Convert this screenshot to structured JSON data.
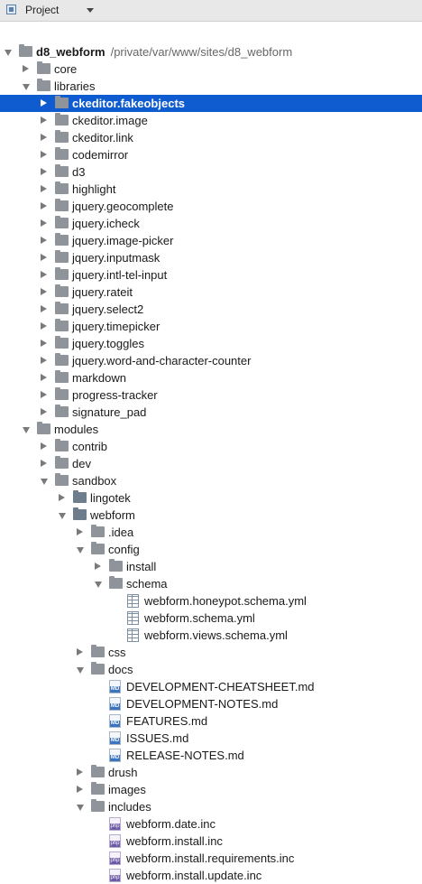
{
  "header": {
    "title": "Project"
  },
  "tree": [
    {
      "label": "d8_webform",
      "path": "/private/var/www/sites/d8_webform",
      "depth": 0,
      "type": "folder",
      "expanded": true,
      "root": true
    },
    {
      "label": "core",
      "depth": 1,
      "type": "folder",
      "expanded": false
    },
    {
      "label": "libraries",
      "depth": 1,
      "type": "folder",
      "expanded": true
    },
    {
      "label": "ckeditor.fakeobjects",
      "depth": 2,
      "type": "folder",
      "expanded": false,
      "selected": true
    },
    {
      "label": "ckeditor.image",
      "depth": 2,
      "type": "folder",
      "expanded": false
    },
    {
      "label": "ckeditor.link",
      "depth": 2,
      "type": "folder",
      "expanded": false
    },
    {
      "label": "codemirror",
      "depth": 2,
      "type": "folder",
      "expanded": false
    },
    {
      "label": "d3",
      "depth": 2,
      "type": "folder",
      "expanded": false
    },
    {
      "label": "highlight",
      "depth": 2,
      "type": "folder",
      "expanded": false
    },
    {
      "label": "jquery.geocomplete",
      "depth": 2,
      "type": "folder",
      "expanded": false
    },
    {
      "label": "jquery.icheck",
      "depth": 2,
      "type": "folder",
      "expanded": false
    },
    {
      "label": "jquery.image-picker",
      "depth": 2,
      "type": "folder",
      "expanded": false
    },
    {
      "label": "jquery.inputmask",
      "depth": 2,
      "type": "folder",
      "expanded": false
    },
    {
      "label": "jquery.intl-tel-input",
      "depth": 2,
      "type": "folder",
      "expanded": false
    },
    {
      "label": "jquery.rateit",
      "depth": 2,
      "type": "folder",
      "expanded": false
    },
    {
      "label": "jquery.select2",
      "depth": 2,
      "type": "folder",
      "expanded": false
    },
    {
      "label": "jquery.timepicker",
      "depth": 2,
      "type": "folder",
      "expanded": false
    },
    {
      "label": "jquery.toggles",
      "depth": 2,
      "type": "folder",
      "expanded": false
    },
    {
      "label": "jquery.word-and-character-counter",
      "depth": 2,
      "type": "folder",
      "expanded": false
    },
    {
      "label": "markdown",
      "depth": 2,
      "type": "folder",
      "expanded": false
    },
    {
      "label": "progress-tracker",
      "depth": 2,
      "type": "folder",
      "expanded": false
    },
    {
      "label": "signature_pad",
      "depth": 2,
      "type": "folder",
      "expanded": false
    },
    {
      "label": "modules",
      "depth": 1,
      "type": "folder",
      "expanded": true
    },
    {
      "label": "contrib",
      "depth": 2,
      "type": "folder",
      "expanded": false
    },
    {
      "label": "dev",
      "depth": 2,
      "type": "folder",
      "expanded": false
    },
    {
      "label": "sandbox",
      "depth": 2,
      "type": "folder",
      "expanded": true
    },
    {
      "label": "lingotek",
      "depth": 3,
      "type": "module",
      "expanded": false
    },
    {
      "label": "webform",
      "depth": 3,
      "type": "module",
      "expanded": true
    },
    {
      "label": ".idea",
      "depth": 4,
      "type": "folder",
      "expanded": false
    },
    {
      "label": "config",
      "depth": 4,
      "type": "folder",
      "expanded": true
    },
    {
      "label": "install",
      "depth": 5,
      "type": "folder",
      "expanded": false
    },
    {
      "label": "schema",
      "depth": 5,
      "type": "folder",
      "expanded": true
    },
    {
      "label": "webform.honeypot.schema.yml",
      "depth": 6,
      "type": "yml"
    },
    {
      "label": "webform.schema.yml",
      "depth": 6,
      "type": "yml"
    },
    {
      "label": "webform.views.schema.yml",
      "depth": 6,
      "type": "yml"
    },
    {
      "label": "css",
      "depth": 4,
      "type": "folder",
      "expanded": false
    },
    {
      "label": "docs",
      "depth": 4,
      "type": "folder",
      "expanded": true
    },
    {
      "label": "DEVELOPMENT-CHEATSHEET.md",
      "depth": 5,
      "type": "md"
    },
    {
      "label": "DEVELOPMENT-NOTES.md",
      "depth": 5,
      "type": "md"
    },
    {
      "label": "FEATURES.md",
      "depth": 5,
      "type": "md"
    },
    {
      "label": "ISSUES.md",
      "depth": 5,
      "type": "md"
    },
    {
      "label": "RELEASE-NOTES.md",
      "depth": 5,
      "type": "md"
    },
    {
      "label": "drush",
      "depth": 4,
      "type": "folder",
      "expanded": false
    },
    {
      "label": "images",
      "depth": 4,
      "type": "folder",
      "expanded": false
    },
    {
      "label": "includes",
      "depth": 4,
      "type": "folder",
      "expanded": true
    },
    {
      "label": "webform.date.inc",
      "depth": 5,
      "type": "php"
    },
    {
      "label": "webform.install.inc",
      "depth": 5,
      "type": "php"
    },
    {
      "label": "webform.install.requirements.inc",
      "depth": 5,
      "type": "php"
    },
    {
      "label": "webform.install.update.inc",
      "depth": 5,
      "type": "php"
    }
  ],
  "icons": {
    "md_badge": "MD",
    "php_badge": "php"
  }
}
